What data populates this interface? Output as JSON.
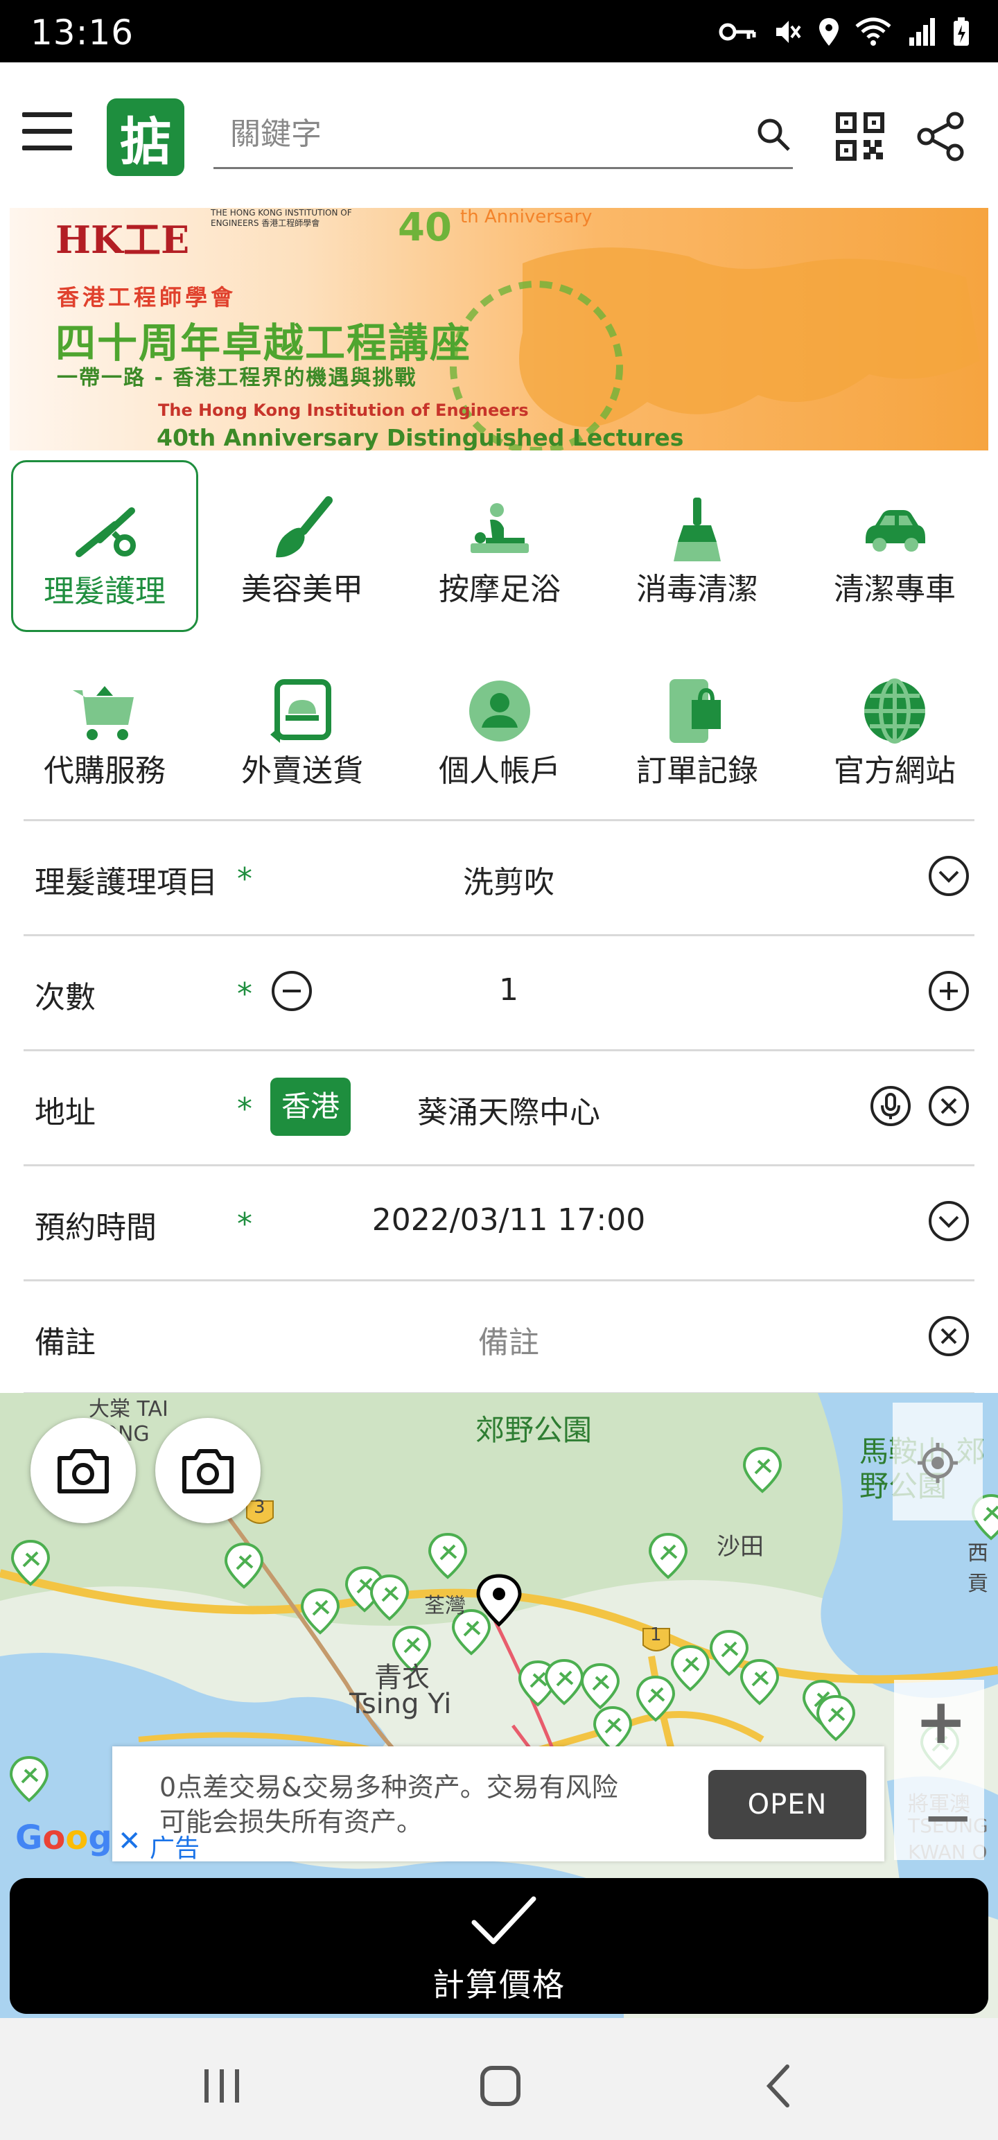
{
  "status_bar": {
    "time": "13:16"
  },
  "app_bar": {
    "logo_char": "掂",
    "search_placeholder": "關鍵字"
  },
  "banner": {
    "logo": "HK工E",
    "org_name": "THE HONG KONG INSTITUTION OF ENGINEERS 香港工程師學會",
    "anniversary_number": "40",
    "anniversary_text": "th Anniversary",
    "line1": "香港工程師學會",
    "line2": "四十周年卓越工程講座",
    "line3": "一帶一路 - 香港工程界的機遇與挑戰",
    "line4": "The Hong Kong Institution of Engineers",
    "line5": "40th Anniversary Distinguished Lectures"
  },
  "categories": [
    {
      "label": "理髮護理",
      "icon": "scissors-icon",
      "selected": true
    },
    {
      "label": "美容美甲",
      "icon": "brush-icon",
      "selected": false
    },
    {
      "label": "按摩足浴",
      "icon": "massage-icon",
      "selected": false
    },
    {
      "label": "消毒清潔",
      "icon": "broom-icon",
      "selected": false
    },
    {
      "label": "清潔專車",
      "icon": "car-icon",
      "selected": false
    },
    {
      "label": "代購服務",
      "icon": "cart-icon",
      "selected": false
    },
    {
      "label": "外賣送貨",
      "icon": "delivery-icon",
      "selected": false
    },
    {
      "label": "個人帳戶",
      "icon": "person-icon",
      "selected": false
    },
    {
      "label": "訂單記錄",
      "icon": "order-bag-icon",
      "selected": false
    },
    {
      "label": "官方網站",
      "icon": "globe-icon",
      "selected": false
    }
  ],
  "form": {
    "service": {
      "label": "理髮護理項目",
      "required": "*",
      "value": "洗剪吹"
    },
    "count": {
      "label": "次數",
      "required": "*",
      "value": "1"
    },
    "address": {
      "label": "地址",
      "required": "*",
      "region": "香港",
      "value": "葵涌天際中心"
    },
    "time": {
      "label": "預約時間",
      "required": "*",
      "value": "2022/03/11 17:00"
    },
    "note": {
      "label": "備註",
      "placeholder": "備註"
    }
  },
  "map": {
    "labels": {
      "tsing_yi_cn": "青衣",
      "tsing_yi_en": "Tsing Yi",
      "tsuen_wan": "荃灣",
      "sha_tin": "沙田",
      "country_park": "郊野公園",
      "country_park_right": "馬鞍山 郊野公園",
      "tai_tong": "大棠 TAI TONG",
      "sai_kung": "西貢",
      "tko_cn": "將軍澳",
      "tko_en": "TSEUNG KWAN O",
      "route_3": "3",
      "route_1": "1"
    },
    "google": "Google"
  },
  "ad": {
    "text": "0点差交易&交易多种资产。交易有风险 可能会损失所有资产。",
    "button": "OPEN",
    "label": "广告",
    "close": "✕"
  },
  "calculate_button": {
    "label": "計算價格"
  },
  "colors": {
    "primary": "#1e8e3e",
    "black": "#000000"
  }
}
